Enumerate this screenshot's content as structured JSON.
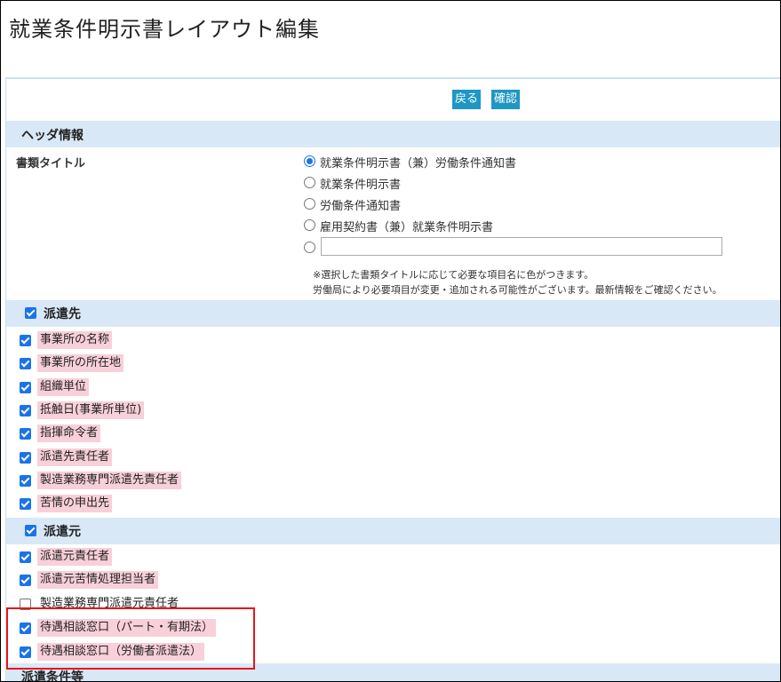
{
  "page": {
    "title": "就業条件明示書レイアウト編集"
  },
  "toolbar": {
    "back_label": "戻る",
    "confirm_label": "確認"
  },
  "header_section": {
    "title": "ヘッダ情報",
    "doc_title_label": "書類タイトル",
    "options": [
      {
        "label": "就業条件明示書（兼）労働条件通知書",
        "selected": true
      },
      {
        "label": "就業条件明示書",
        "selected": false
      },
      {
        "label": "労働条件通知書",
        "selected": false
      },
      {
        "label": "雇用契約書（兼）就業条件明示書",
        "selected": false
      },
      {
        "label": "",
        "selected": false,
        "custom_value": ""
      }
    ],
    "note_line1": "※選択した書類タイトルに応じて必要な項目名に色がつきます。",
    "note_line2": "労働局により必要項目が変更・追加される可能性がございます。最新情報をご確認ください。"
  },
  "destination_section": {
    "title": "派遣先",
    "checked": true,
    "items": [
      {
        "label": "事業所の名称",
        "checked": true,
        "required": true
      },
      {
        "label": "事業所の所在地",
        "checked": true,
        "required": true
      },
      {
        "label": "組織単位",
        "checked": true,
        "required": true
      },
      {
        "label": "抵触日(事業所単位)",
        "checked": true,
        "required": true
      },
      {
        "label": "指揮命令者",
        "checked": true,
        "required": true
      },
      {
        "label": "派遣先責任者",
        "checked": true,
        "required": true
      },
      {
        "label": "製造業務専門派遣先責任者",
        "checked": true,
        "required": true
      },
      {
        "label": "苦情の申出先",
        "checked": true,
        "required": true
      }
    ]
  },
  "source_section": {
    "title": "派遣元",
    "checked": true,
    "items": [
      {
        "label": "派遣元責任者",
        "checked": true,
        "required": true
      },
      {
        "label": "派遣元苦情処理担当者",
        "checked": true,
        "required": true
      },
      {
        "label": "製造業務専門派遣元責任者",
        "checked": false,
        "required": false
      },
      {
        "label": "待遇相談窓口（パート・有期法）",
        "checked": true,
        "required": true
      },
      {
        "label": "待遇相談窓口（労働者派遣法）",
        "checked": true,
        "required": true
      }
    ]
  },
  "conditions_section": {
    "title": "派遣条件等"
  },
  "colors": {
    "accent": "#1f97c4",
    "section_bg": "#d9e8f6",
    "required_bg": "#f8d0da",
    "highlight": "#e8141c"
  }
}
